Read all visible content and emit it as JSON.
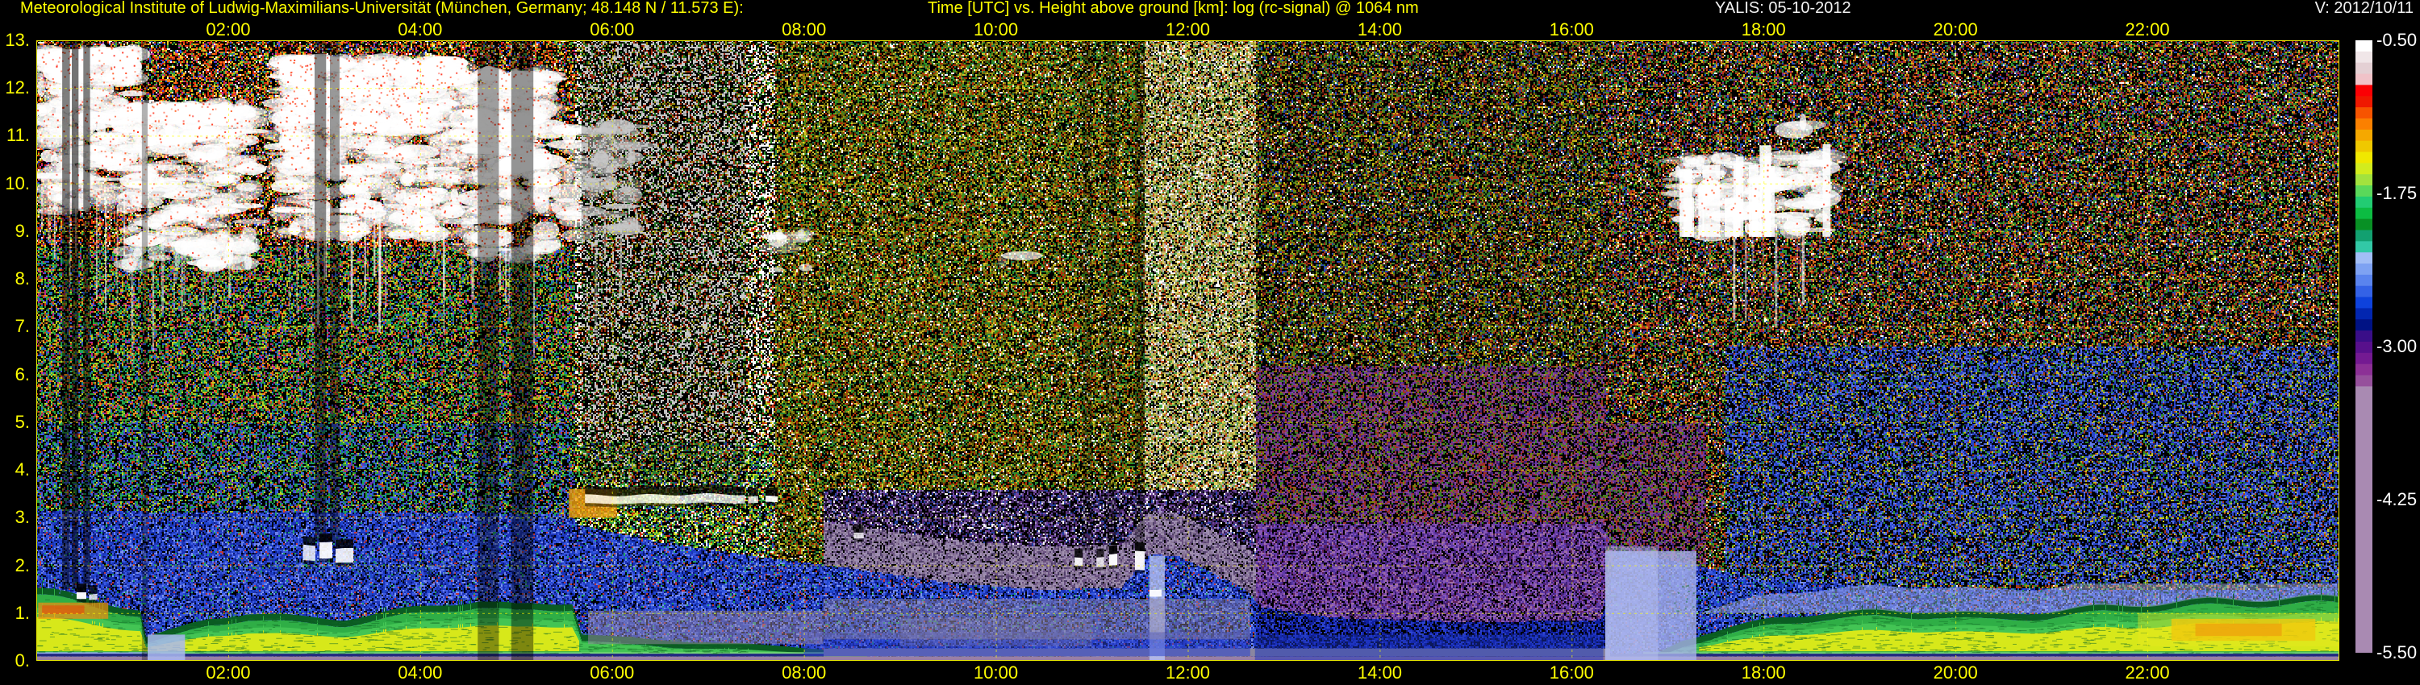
{
  "header": {
    "institute": "Meteorological Institute of Ludwig-Maximilians-Universität (München, Germany; 48.148 N / 11.573 E):",
    "plot_title": "Time [UTC] vs. Height above ground [km]: log (rc-signal) @ 1064 nm",
    "instrument_date": "YALIS: 05-10-2012",
    "version": "V: 2012/10/11"
  },
  "chart_data": {
    "type": "heatmap",
    "title": "Time [UTC] vs. Height above ground [km]: log (rc-signal) @ 1064 nm",
    "instrument": "YALIS",
    "date": "05-10-2012",
    "wavelength": "1064 nm",
    "signal": "log (rc-signal)",
    "xlabel": "Time [UTC]",
    "ylabel": "Height above ground [km]",
    "x_range_hours": [
      0,
      24
    ],
    "y_range_km": [
      0,
      13
    ],
    "grid": {
      "style": "dashed",
      "color": "#ffff00",
      "x_every_hours": 2,
      "y_every_km": 1
    },
    "x_ticks": [
      {
        "label": "02:00",
        "hour": 2
      },
      {
        "label": "04:00",
        "hour": 4
      },
      {
        "label": "06:00",
        "hour": 6
      },
      {
        "label": "08:00",
        "hour": 8
      },
      {
        "label": "10:00",
        "hour": 10
      },
      {
        "label": "12:00",
        "hour": 12
      },
      {
        "label": "14:00",
        "hour": 14
      },
      {
        "label": "16:00",
        "hour": 16
      },
      {
        "label": "18:00",
        "hour": 18
      },
      {
        "label": "20:00",
        "hour": 20
      },
      {
        "label": "22:00",
        "hour": 22
      }
    ],
    "y_ticks": [
      {
        "label": "13.",
        "km": 13
      },
      {
        "label": "12.",
        "km": 12
      },
      {
        "label": "11.",
        "km": 11
      },
      {
        "label": "10.",
        "km": 10
      },
      {
        "label": "9.",
        "km": 9
      },
      {
        "label": "8.",
        "km": 8
      },
      {
        "label": "7.",
        "km": 7
      },
      {
        "label": "6.",
        "km": 6
      },
      {
        "label": "5.",
        "km": 5
      },
      {
        "label": "4.",
        "km": 4
      },
      {
        "label": "3.",
        "km": 3
      },
      {
        "label": "2.",
        "km": 2
      },
      {
        "label": "1.",
        "km": 1
      },
      {
        "label": "0.",
        "km": 0
      }
    ],
    "colorbar": {
      "ticks": [
        {
          "label": "-0.50",
          "frac": 0.0
        },
        {
          "label": "-1.75",
          "frac": 0.25
        },
        {
          "label": "-3.00",
          "frac": 0.5
        },
        {
          "label": "-4.25",
          "frac": 0.75
        },
        {
          "label": "-5.50",
          "frac": 1.0
        }
      ],
      "segments": [
        "#ffffff",
        "#f0e6e8",
        "#e4d0d4",
        "#f0c2c8",
        "#fb0004",
        "#ef1800",
        "#f75400",
        "#fb8000",
        "#f5a800",
        "#efc800",
        "#f0e800",
        "#d2ec1e",
        "#a2e23e",
        "#5ad85a",
        "#22cc72",
        "#0cbc42",
        "#089024",
        "#12a070",
        "#32c8a6",
        "#a2bef6",
        "#7ea2f2",
        "#5a84ee",
        "#3462e6",
        "#0e42dc",
        "#0226b0",
        "#001284",
        "#3a0e88",
        "#58108c",
        "#741a92",
        "#8c3096",
        "#96509c"
      ],
      "bottom_color": "#a98ab2",
      "bottom_start_frac": 0.565
    },
    "palettes": {
      "nightHigh": {
        "c": [
          "#000000",
          "#e03010",
          "#ff7818",
          "#ffd020",
          "#38a040",
          "#3050d8",
          "#c030a0",
          "#ffffff",
          "#7a2810",
          "#b8c820"
        ],
        "w": [
          0.44,
          0.13,
          0.09,
          0.05,
          0.09,
          0.05,
          0.03,
          0.04,
          0.04,
          0.04
        ]
      },
      "nightMid": {
        "c": [
          "#000000",
          "#28a038",
          "#b8d020",
          "#d84018",
          "#3058d0",
          "#f08820",
          "#18a078",
          "#806020",
          "#c02890"
        ],
        "w": [
          0.42,
          0.15,
          0.09,
          0.07,
          0.09,
          0.05,
          0.05,
          0.04,
          0.04
        ]
      },
      "nightLow": {
        "c": [
          "#000000",
          "#2c50c8",
          "#28a038",
          "#b8d020",
          "#d84018",
          "#6838b0",
          "#18a078",
          "#4868e0"
        ],
        "w": [
          0.42,
          0.14,
          0.12,
          0.06,
          0.05,
          0.06,
          0.07,
          0.08
        ]
      },
      "dawnBW": {
        "c": [
          "#000000",
          "#ffffff",
          "#c83010",
          "#289028",
          "#c8b810",
          "#d0d0d0"
        ],
        "w": [
          0.44,
          0.26,
          0.09,
          0.09,
          0.06,
          0.06
        ]
      },
      "dawnGreen": {
        "c": [
          "#000000",
          "#30a040",
          "#c8d820",
          "#ffffff",
          "#2848b0",
          "#c83010"
        ],
        "w": [
          0.38,
          0.22,
          0.14,
          0.1,
          0.08,
          0.08
        ]
      },
      "dayOlive": {
        "c": [
          "#000000",
          "#6b6b08",
          "#9a8a18",
          "#b03008",
          "#309028",
          "#ffffff",
          "#d0c028",
          "#504008",
          "#207850"
        ],
        "w": [
          0.34,
          0.12,
          0.09,
          0.1,
          0.11,
          0.05,
          0.08,
          0.06,
          0.05
        ]
      },
      "dayLight": {
        "c": [
          "#000000",
          "#9a9a30",
          "#c0b060",
          "#c04818",
          "#50a048",
          "#ffffff",
          "#e0d060",
          "#b0b0b0"
        ],
        "w": [
          0.26,
          0.12,
          0.1,
          0.09,
          0.11,
          0.12,
          0.1,
          0.1
        ]
      },
      "afternoon": {
        "c": [
          "#000000",
          "#3a8028",
          "#a83818",
          "#808008",
          "#2848b0",
          "#c8b818",
          "#601818",
          "#ffffff",
          "#284818"
        ],
        "w": [
          0.42,
          0.13,
          0.11,
          0.08,
          0.06,
          0.06,
          0.06,
          0.03,
          0.05
        ]
      },
      "evening": {
        "c": [
          "#000000",
          "#b83418",
          "#309030",
          "#e08020",
          "#2850b8",
          "#c8c020",
          "#782078",
          "#ffffff",
          "#583010"
        ],
        "w": [
          0.44,
          0.12,
          0.13,
          0.06,
          0.07,
          0.05,
          0.04,
          0.03,
          0.06
        ]
      },
      "eveningBlue": {
        "c": [
          "#000000",
          "#2844c8",
          "#4862e8",
          "#182880",
          "#309030",
          "#a83818",
          "#c8c020",
          "#6078e8"
        ],
        "w": [
          0.38,
          0.17,
          0.1,
          0.09,
          0.08,
          0.05,
          0.05,
          0.08
        ]
      },
      "blueField": {
        "c": [
          "#000000",
          "#1c34b8",
          "#3c58e0",
          "#0c1878",
          "#6a80ec",
          "#2048d0",
          "#20a068",
          "#c03838",
          "#8098f0"
        ],
        "w": [
          0.16,
          0.22,
          0.18,
          0.14,
          0.08,
          0.12,
          0.03,
          0.03,
          0.04
        ]
      },
      "blueFieldDim": {
        "c": [
          "#000000",
          "#1020a0",
          "#2438c8",
          "#0a1060",
          "#3048d0"
        ],
        "w": [
          0.3,
          0.26,
          0.2,
          0.14,
          0.1
        ]
      },
      "mauveField": {
        "c": [
          "#000000",
          "#8a7898",
          "#6a5080",
          "#a090b0",
          "#504068",
          "#9888b0"
        ],
        "w": [
          0.12,
          0.24,
          0.2,
          0.18,
          0.14,
          0.12
        ]
      },
      "purpleDark": {
        "c": [
          "#000000",
          "#583078",
          "#7048a0",
          "#302050",
          "#a090c0",
          "#ffffff",
          "#2040a0"
        ],
        "w": [
          0.4,
          0.14,
          0.12,
          0.12,
          0.08,
          0.06,
          0.08
        ]
      },
      "purpleField": {
        "c": [
          "#000000",
          "#7040a8",
          "#8858b8",
          "#402078",
          "#a070a0",
          "#602058",
          "#5838a8"
        ],
        "w": [
          0.2,
          0.18,
          0.16,
          0.16,
          0.1,
          0.1,
          0.1
        ]
      },
      "afternoonPurple": {
        "c": [
          "#000000",
          "#6838a0",
          "#884898",
          "#a03028",
          "#3a8028",
          "#808008",
          "#402078",
          "#903860"
        ],
        "w": [
          0.34,
          0.13,
          0.1,
          0.1,
          0.09,
          0.07,
          0.09,
          0.08
        ]
      }
    },
    "profiles": {
      "blueTop": [
        [
          0,
          3.15
        ],
        [
          5.55,
          3.1
        ],
        [
          5.65,
          2.85
        ],
        [
          6.5,
          2.5
        ],
        [
          7.5,
          2.2
        ],
        [
          8.5,
          1.95
        ],
        [
          9.5,
          1.65
        ],
        [
          10.5,
          1.5
        ],
        [
          11.3,
          1.55
        ],
        [
          11.6,
          2.25
        ],
        [
          11.9,
          2.2
        ],
        [
          12.6,
          1.5
        ],
        [
          12.75,
          1.15
        ],
        [
          13.5,
          0.92
        ],
        [
          15,
          0.82
        ],
        [
          16.3,
          0.88
        ],
        [
          16.45,
          2.35
        ],
        [
          17.2,
          2.05
        ],
        [
          18,
          1.7
        ],
        [
          19,
          1.6
        ],
        [
          21,
          1.52
        ],
        [
          23,
          1.5
        ],
        [
          24,
          1.62
        ]
      ],
      "greenTop": [
        [
          0,
          1.42
        ],
        [
          0.5,
          1.22
        ],
        [
          0.9,
          1.08
        ],
        [
          1.08,
          1.02
        ],
        [
          1.14,
          0.45
        ],
        [
          1.45,
          0.62
        ],
        [
          1.8,
          0.85
        ],
        [
          2.2,
          0.98
        ],
        [
          2.7,
          0.88
        ],
        [
          3.2,
          0.82
        ],
        [
          3.7,
          0.95
        ],
        [
          4.2,
          1.08
        ],
        [
          4.6,
          1.16
        ],
        [
          5.0,
          1.06
        ],
        [
          5.35,
          1.12
        ],
        [
          5.58,
          1.18
        ],
        [
          5.68,
          0.52
        ],
        [
          6.2,
          0.42
        ],
        [
          7.0,
          0.34
        ],
        [
          7.8,
          0.26
        ],
        [
          8.4,
          0.14
        ],
        [
          8.8,
          0.02
        ],
        [
          16.6,
          0.02
        ],
        [
          16.9,
          0.12
        ],
        [
          17.15,
          0.38
        ],
        [
          17.6,
          0.62
        ],
        [
          18.1,
          0.82
        ],
        [
          18.6,
          0.95
        ],
        [
          19.2,
          1.02
        ],
        [
          19.8,
          1.06
        ],
        [
          20.3,
          0.98
        ],
        [
          20.9,
          1.02
        ],
        [
          21.5,
          1.1
        ],
        [
          22.2,
          1.16
        ],
        [
          23,
          1.24
        ],
        [
          24,
          1.32
        ]
      ]
    },
    "overlays": [
      [
        0.02,
        0.75,
        0.88,
        1.22,
        "#f08c10",
        0.7
      ],
      [
        0.06,
        0.5,
        0.98,
        1.16,
        "#e84808",
        0.6
      ],
      [
        22.25,
        23.75,
        0.42,
        0.88,
        "#f5b400",
        0.8
      ],
      [
        22.5,
        23.4,
        0.52,
        0.78,
        "#f07800",
        0.8
      ],
      [
        21.9,
        24.0,
        0.3,
        1.0,
        "#e8e820",
        0.4
      ],
      [
        5.55,
        6.05,
        3.0,
        3.6,
        "#f0a010",
        0.8
      ],
      [
        6.0,
        6.7,
        3.25,
        3.6,
        "#c8d820",
        0.45
      ],
      [
        1.16,
        1.55,
        0.0,
        0.55,
        "#aab8f0",
        0.85
      ],
      [
        11.6,
        11.76,
        0.0,
        2.2,
        "#b8c4f4",
        0.8
      ],
      [
        16.35,
        17.3,
        0.0,
        2.3,
        "#a8b2ea",
        0.8
      ],
      [
        16.35,
        16.9,
        0.0,
        2.4,
        "#b8c0f0",
        0.5
      ],
      [
        8.0,
        12.65,
        0.1,
        0.6,
        "#2c42cc",
        0.55
      ],
      [
        12.7,
        16.33,
        0.0,
        0.55,
        "#1830b8",
        0.5
      ],
      [
        5.75,
        8.2,
        0.35,
        1.05,
        "#998aa6",
        0.5
      ],
      [
        8.2,
        12.65,
        0.45,
        1.3,
        "#93889f",
        0.45
      ],
      [
        9.0,
        11.0,
        0.3,
        0.9,
        "#8a80a0",
        0.3
      ]
    ],
    "speckle_overlays": [
      [
        1.9,
        4.6,
        1.75,
        2.2,
        "#17702c",
        0.55,
        0.25
      ],
      [
        17.0,
        20.0,
        1.0,
        1.6,
        "#15702a",
        0.5,
        0.2
      ],
      [
        20.0,
        24.0,
        1.2,
        1.7,
        "#15702a",
        0.5,
        0.25
      ],
      [
        0.2,
        5.5,
        1.3,
        2.7,
        "#5a74e8",
        0.5,
        0.18
      ]
    ],
    "cirrus_clouds": [
      [
        0.0,
        1.02,
        9.4,
        12.75,
        1.0,
        "mass"
      ],
      [
        0.95,
        2.25,
        8.3,
        11.6,
        0.9,
        "mass"
      ],
      [
        2.55,
        4.42,
        8.9,
        12.55,
        1.1,
        "mass"
      ],
      [
        4.45,
        5.35,
        8.5,
        12.3,
        0.9,
        "mass"
      ],
      [
        5.5,
        6.25,
        8.9,
        11.2,
        0.5,
        "mass"
      ],
      [
        7.55,
        8.05,
        8.15,
        8.95,
        0.35,
        "mass"
      ],
      [
        10.05,
        10.3,
        8.3,
        8.75,
        0.3,
        "mass"
      ],
      [
        17.05,
        18.65,
        8.95,
        10.55,
        0.6,
        "plume"
      ],
      [
        18.2,
        18.5,
        10.85,
        11.35,
        0.3,
        "mass"
      ]
    ],
    "low_clouds": [
      [
        5.72,
        7.38,
        3.3,
        3.48,
        "capped"
      ],
      [
        7.42,
        7.52,
        3.3,
        3.44,
        "capped"
      ],
      [
        7.6,
        7.72,
        3.32,
        3.44,
        "capped"
      ],
      [
        2.78,
        2.9,
        2.1,
        2.42,
        "capped"
      ],
      [
        2.95,
        3.08,
        2.15,
        2.5,
        "capped"
      ],
      [
        3.12,
        3.3,
        2.05,
        2.35,
        "capped"
      ],
      [
        0.42,
        0.52,
        1.3,
        1.45,
        "capped"
      ],
      [
        0.55,
        0.63,
        1.28,
        1.4,
        "capped"
      ],
      [
        8.52,
        8.62,
        2.58,
        2.72,
        "capped"
      ],
      [
        10.82,
        10.9,
        2.0,
        2.18,
        "capped"
      ],
      [
        11.05,
        11.12,
        1.98,
        2.2,
        "capped"
      ],
      [
        11.18,
        11.26,
        2.0,
        2.24,
        "capped"
      ],
      [
        11.45,
        11.55,
        1.9,
        2.3,
        "capped"
      ],
      [
        11.6,
        11.72,
        1.35,
        1.5,
        "plain"
      ]
    ],
    "dark_columns": [
      [
        0.27,
        0.35,
        1.5,
        13,
        0.5
      ],
      [
        0.37,
        0.44,
        1.5,
        13,
        0.55
      ],
      [
        0.49,
        0.56,
        1.5,
        13,
        0.5
      ],
      [
        1.1,
        1.16,
        0.0,
        13,
        0.3
      ],
      [
        2.9,
        3.02,
        2.5,
        13,
        0.45
      ],
      [
        3.06,
        3.16,
        2.5,
        13,
        0.4
      ],
      [
        4.6,
        4.82,
        0.0,
        13,
        0.38
      ],
      [
        4.95,
        5.18,
        0.0,
        13,
        0.42
      ],
      [
        5.68,
        7.4,
        3.72,
        13,
        0.22
      ],
      [
        10.9,
        11.0,
        2.3,
        13,
        0.25
      ],
      [
        11.15,
        11.25,
        2.3,
        13,
        0.25
      ],
      [
        11.45,
        11.55,
        2.3,
        13,
        0.3
      ]
    ]
  }
}
